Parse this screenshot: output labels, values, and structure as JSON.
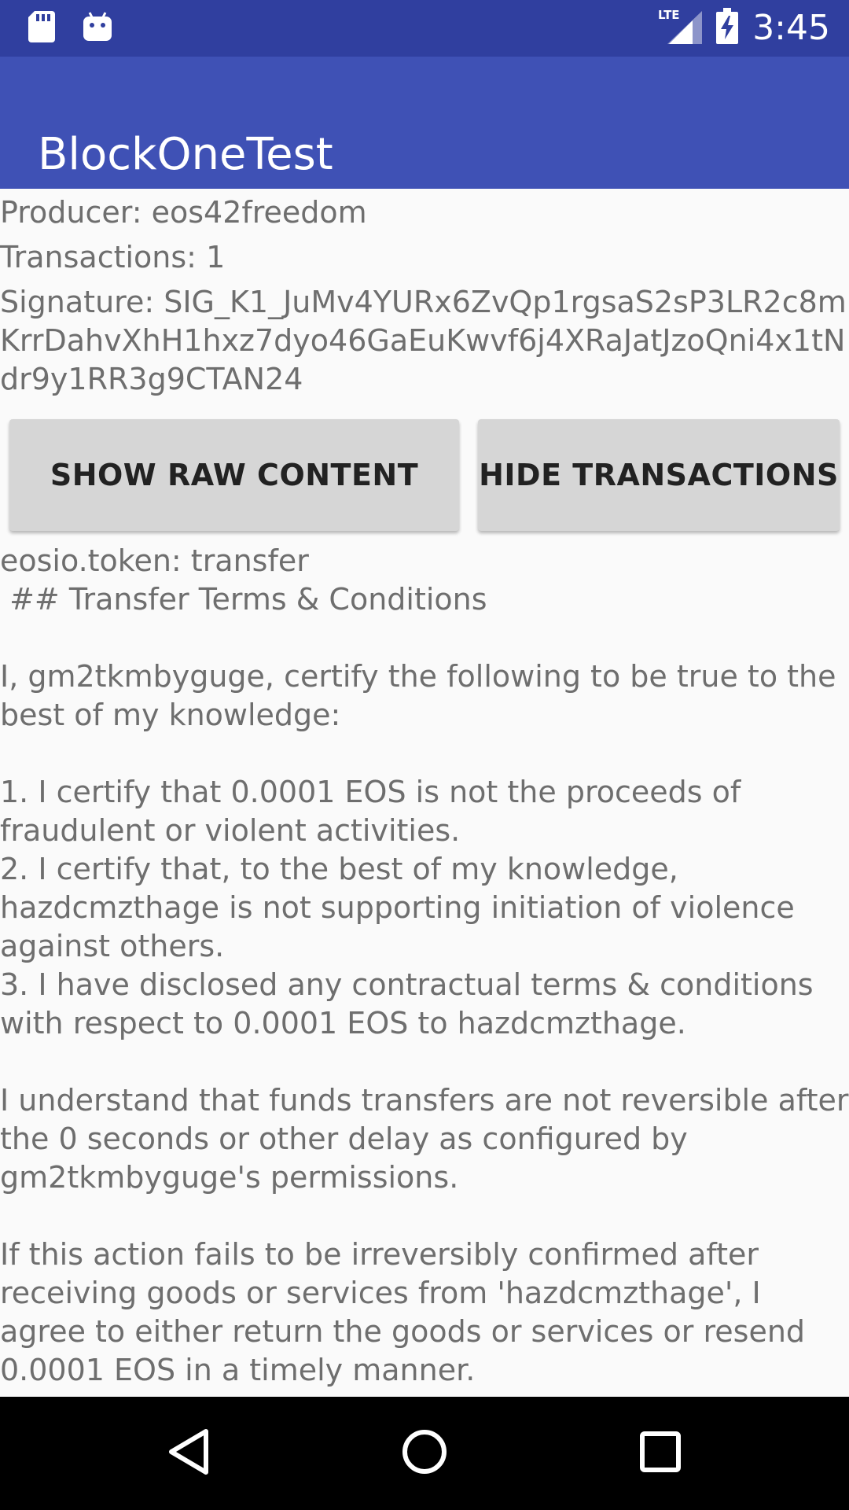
{
  "status_bar": {
    "time": "3:45",
    "network_label": "LTE",
    "icons": [
      "sd-card-icon",
      "android-icon",
      "lte-signal-icon",
      "battery-charging-icon"
    ],
    "background_color": "#303f9f"
  },
  "app_bar": {
    "title": "BlockOneTest",
    "background_color": "#3f51b5"
  },
  "block_info": {
    "producer": "Producer: eos42freedom",
    "transactions": "Transactions: 1",
    "signature": "Signature: SIG_K1_JuMv4YURx6ZvQp1rgsaS2sP3LR2c8mKrrDahvXhH1hxz7dyo46GaEuKwvf6j4XRaJatJzoQni4x1tNdr9y1RR3g9CTAN24"
  },
  "buttons": {
    "show_raw": "SHOW RAW CONTENT",
    "hide_transactions": "HIDE TRANSACTIONS"
  },
  "transaction": {
    "text": "eosio.token: transfer\n ## Transfer Terms & Conditions\n\nI, gm2tkmbyguge, certify the following to be true to the best of my knowledge:\n\n1. I certify that 0.0001 EOS is not the proceeds of fraudulent or violent activities.\n2. I certify that, to the best of my knowledge, hazdcmzthage is not supporting initiation of violence against others.\n3. I have disclosed any contractual terms & conditions with respect to 0.0001 EOS to hazdcmzthage.\n\nI understand that funds transfers are not reversible after the 0 seconds or other delay as configured by gm2tkmbyguge's permissions.\n\nIf this action fails to be irreversibly confirmed after receiving goods or services from 'hazdcmzthage', I agree to either return the goods or services or resend 0.0001 EOS in a timely manner."
  },
  "nav_bar": {
    "icons": [
      "back-icon",
      "home-icon",
      "recents-icon"
    ]
  }
}
